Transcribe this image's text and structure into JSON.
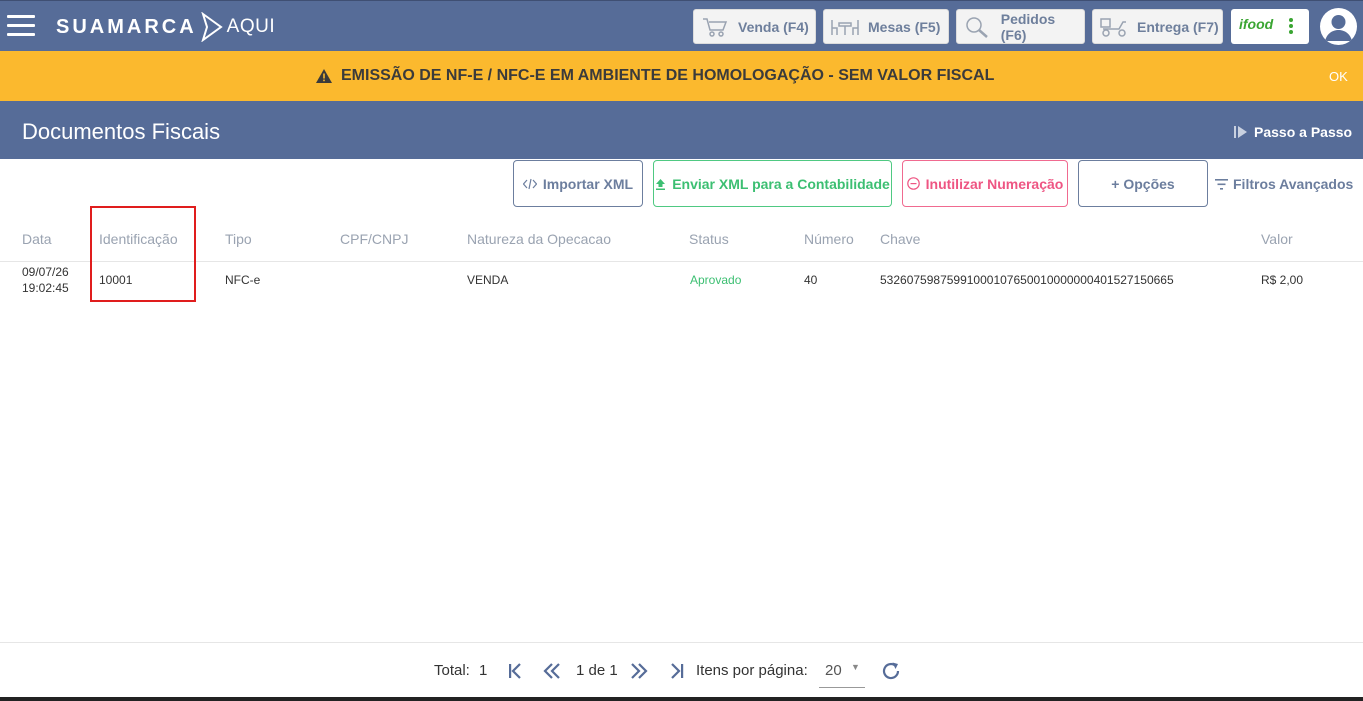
{
  "header": {
    "brand": "SUAMARCA",
    "brand_suffix": "AQUI",
    "nav": [
      {
        "label": "Venda (F4)"
      },
      {
        "label": "Mesas (F5)"
      },
      {
        "label": "Pedidos (F6)"
      },
      {
        "label": "Entrega (F7)"
      }
    ],
    "ifood_label": "ifood"
  },
  "banner": {
    "message": "EMISSÃO DE NF-E / NFC-E EM AMBIENTE DE HOMOLOGAÇÃO - SEM VALOR FISCAL",
    "ok_label": "OK",
    "color": "#fbb92e"
  },
  "page": {
    "title": "Documentos Fiscais",
    "step_label": "Passo a Passo"
  },
  "actions": {
    "import_label": "Importar XML",
    "send_label": "Enviar XML para a Contabilidade",
    "inutilize_label": "Inutilizar Numeração",
    "options_label": "+ Opções",
    "filters_label": "Filtros Avançados"
  },
  "table": {
    "columns": [
      "Data",
      "Identificação",
      "Tipo",
      "CPF/CNPJ",
      "Natureza da Opecacao",
      "Status",
      "Número",
      "Chave",
      "Valor"
    ],
    "rows": [
      {
        "date": "09/07/26",
        "time": "19:02:45",
        "id": "10001",
        "type": "NFC-e",
        "cpf": "",
        "nature": "VENDA",
        "status": "Aprovado",
        "number": "40",
        "key": "53260759875991000107650010000000401527150665",
        "value": "R$ 2,00"
      }
    ]
  },
  "pagination": {
    "total_label": "Total:",
    "total": "1",
    "page_info": "1 de 1",
    "per_page_label": "Itens por página:",
    "per_page": "20"
  },
  "colors": {
    "primary": "#566c98",
    "success": "#3cbf72",
    "danger": "#ee5583",
    "highlight": "#e01d1d"
  }
}
